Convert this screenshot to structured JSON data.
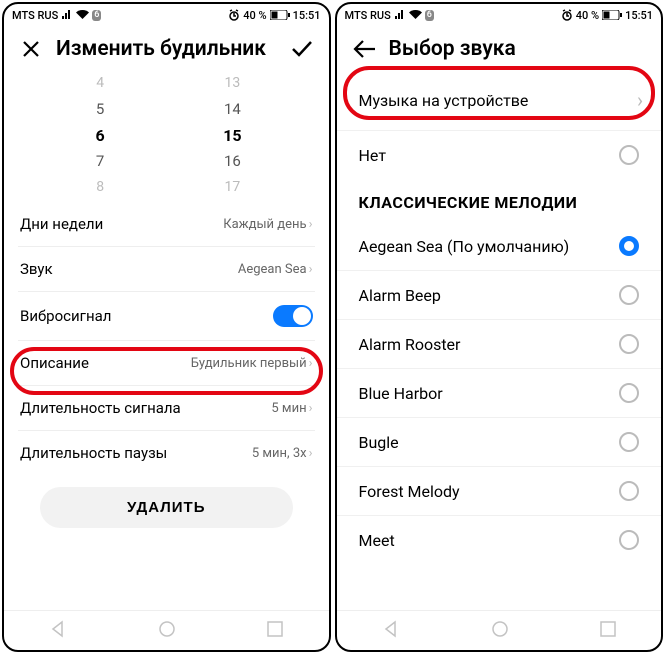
{
  "status": {
    "carrier": "MTS RUS",
    "sig_count": "6",
    "battery_pct": "40 %",
    "time": "15:51"
  },
  "left": {
    "title": "Изменить будильник",
    "wheel_hours": [
      "4",
      "5",
      "6",
      "7",
      "8"
    ],
    "wheel_minutes": [
      "13",
      "14",
      "15",
      "16",
      "17"
    ],
    "rows": {
      "days": {
        "label": "Дни недели",
        "value": "Каждый день"
      },
      "sound": {
        "label": "Звук",
        "value": "Aegean Sea"
      },
      "vibrate": {
        "label": "Вибросигнал"
      },
      "desc": {
        "label": "Описание",
        "value": "Будильник первый"
      },
      "signal_len": {
        "label": "Длительность сигнала",
        "value": "5 мин"
      },
      "pause_len": {
        "label": "Длительность паузы",
        "value": "5 мин, 3x"
      }
    },
    "delete": "УДАЛИТЬ"
  },
  "right": {
    "title": "Выбор звука",
    "music_on_device": "Музыка на устройстве",
    "none": "Нет",
    "section": "КЛАССИЧЕСКИЕ МЕЛОДИИ",
    "melodies": [
      {
        "name": "Aegean Sea (По умолчанию)",
        "checked": true
      },
      {
        "name": "Alarm Beep",
        "checked": false
      },
      {
        "name": "Alarm Rooster",
        "checked": false
      },
      {
        "name": "Blue Harbor",
        "checked": false
      },
      {
        "name": "Bugle",
        "checked": false
      },
      {
        "name": "Forest Melody",
        "checked": false
      },
      {
        "name": "Meet",
        "checked": false
      }
    ]
  }
}
